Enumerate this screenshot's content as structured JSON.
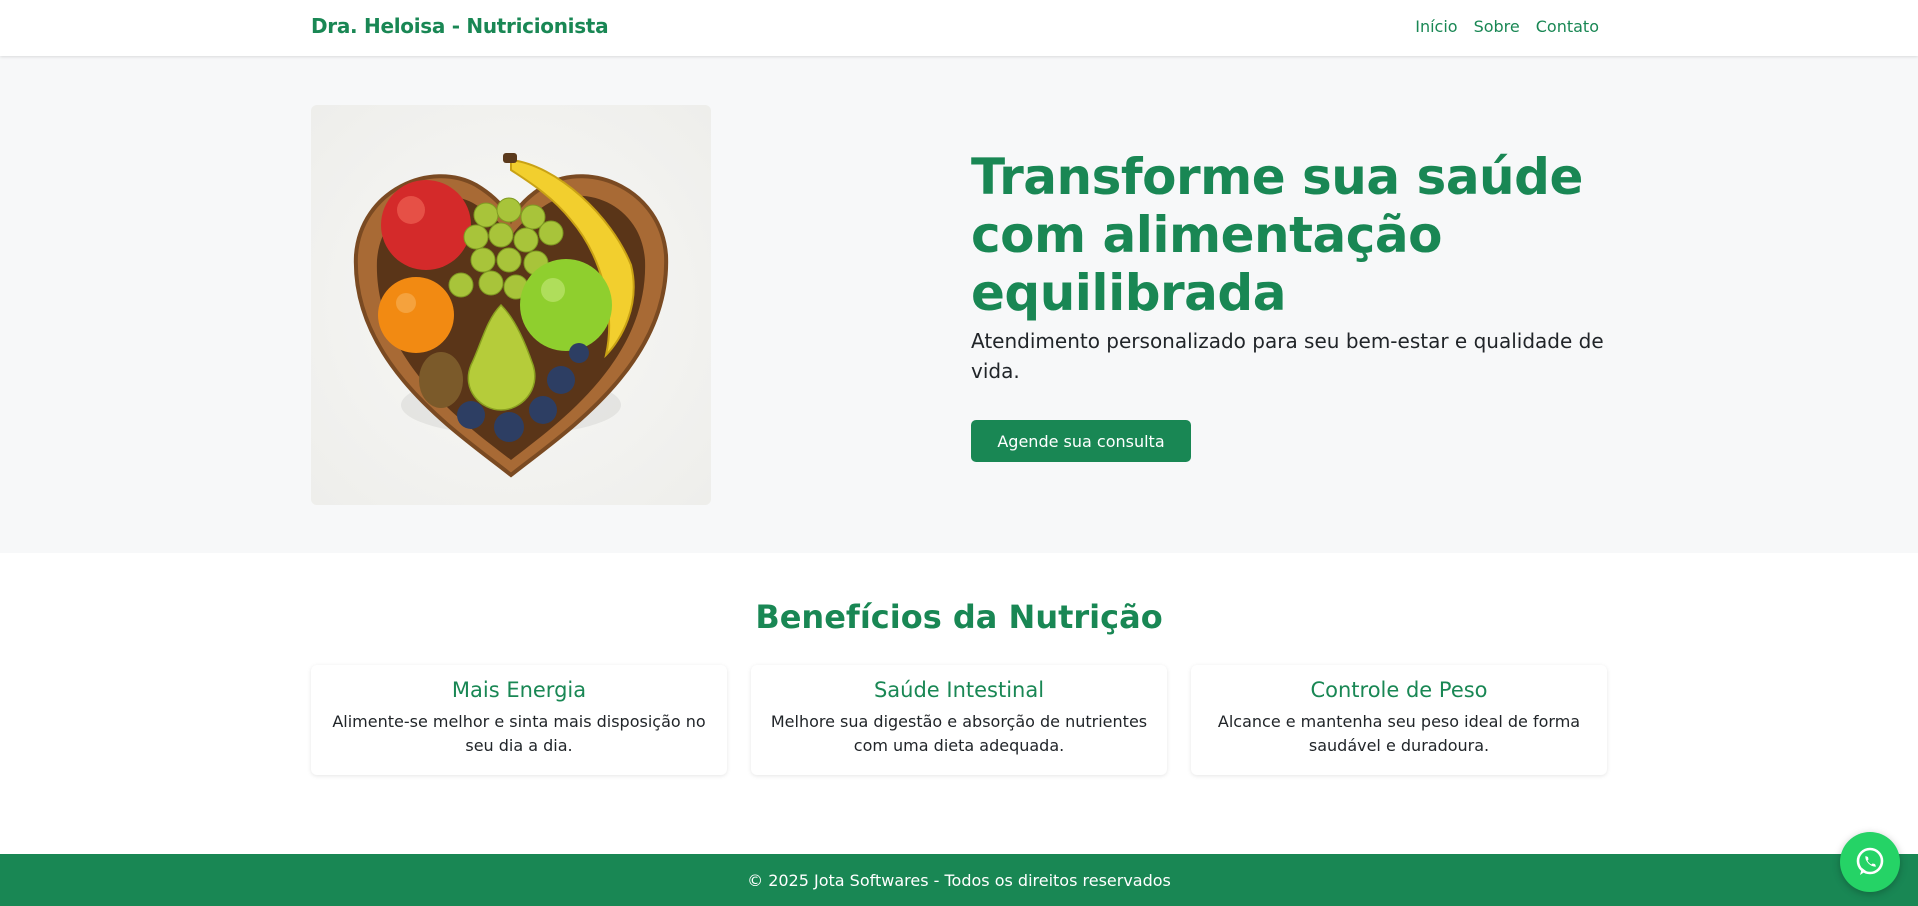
{
  "navbar": {
    "brand": "Dra. Heloisa - Nutricionista",
    "links": [
      "Início",
      "Sobre",
      "Contato"
    ]
  },
  "hero": {
    "title": "Transforme sua saúde com alimentação equilibrada",
    "subtitle": "Atendimento personalizado para seu bem-estar e qualidade de vida.",
    "cta": "Agende sua consulta"
  },
  "benefits": {
    "title": "Benefícios da Nutrição",
    "cards": [
      {
        "title": "Mais Energia",
        "text": "Alimente-se melhor e sinta mais disposição no seu dia a dia."
      },
      {
        "title": "Saúde Intestinal",
        "text": "Melhore sua digestão e absorção de nutrientes com uma dieta adequada."
      },
      {
        "title": "Controle de Peso",
        "text": "Alcance e mantenha seu peso ideal de forma saudável e duradoura."
      }
    ]
  },
  "footer": {
    "text": "© 2025 Jota Softwares - Todos os direitos reservados"
  },
  "floating": {
    "icon": "whatsapp-icon"
  },
  "colors": {
    "primary": "#198754",
    "hero_bg": "#f7f8f9",
    "whatsapp": "#25d366"
  }
}
